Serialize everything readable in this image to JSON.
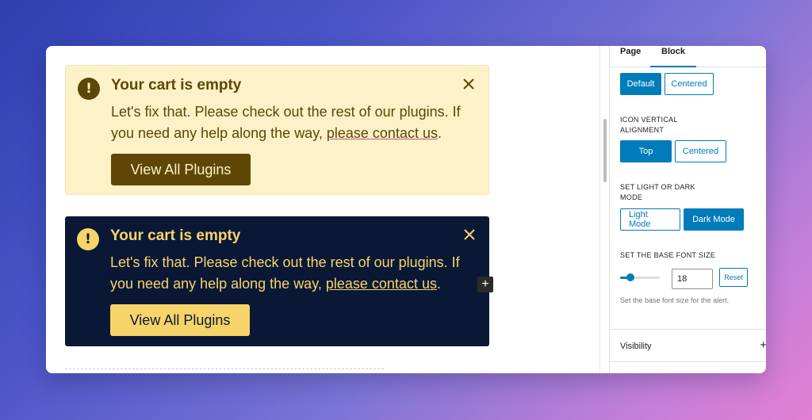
{
  "alerts": [
    {
      "title": "Your cart is empty",
      "body_prefix": "Let's fix that. Please check out the rest of our plugins. If you need any help along the way, ",
      "link_text": "please contact us",
      "body_suffix": ".",
      "button_label": "View All Plugins",
      "icon": "!",
      "mode": "light"
    },
    {
      "title": "Your cart is empty",
      "body_prefix": "Let's fix that. Please check out the rest of our plugins. If you need any help along the way, ",
      "link_text": "please contact us",
      "body_suffix": ".",
      "button_label": "View All Plugins",
      "icon": "!",
      "mode": "dark"
    }
  ],
  "add_block_icon": "+",
  "sidebar": {
    "tabs": {
      "page": "Page",
      "block": "Block"
    },
    "style_options": [
      "Default",
      "Centered"
    ],
    "icon_alignment": {
      "label": "ICON VERTICAL ALIGNMENT",
      "options": [
        "Top",
        "Centered"
      ],
      "selected": "Top"
    },
    "theme": {
      "label": "SET LIGHT OR DARK MODE",
      "options": [
        "Light Mode",
        "Dark Mode"
      ],
      "selected": "Dark Mode"
    },
    "font_size": {
      "label": "SET THE BASE FONT SIZE",
      "value": "18",
      "reset_label": "Reset",
      "help": "Set the base font size for the alert."
    },
    "visibility": {
      "label": "Visibility",
      "toggle_icon": "+"
    }
  },
  "colors": {
    "light_bg": "#fdf1c8",
    "light_fg": "#5e4706",
    "dark_bg": "#0a1836",
    "dark_fg": "#f7d46a",
    "accent": "#007cba"
  }
}
